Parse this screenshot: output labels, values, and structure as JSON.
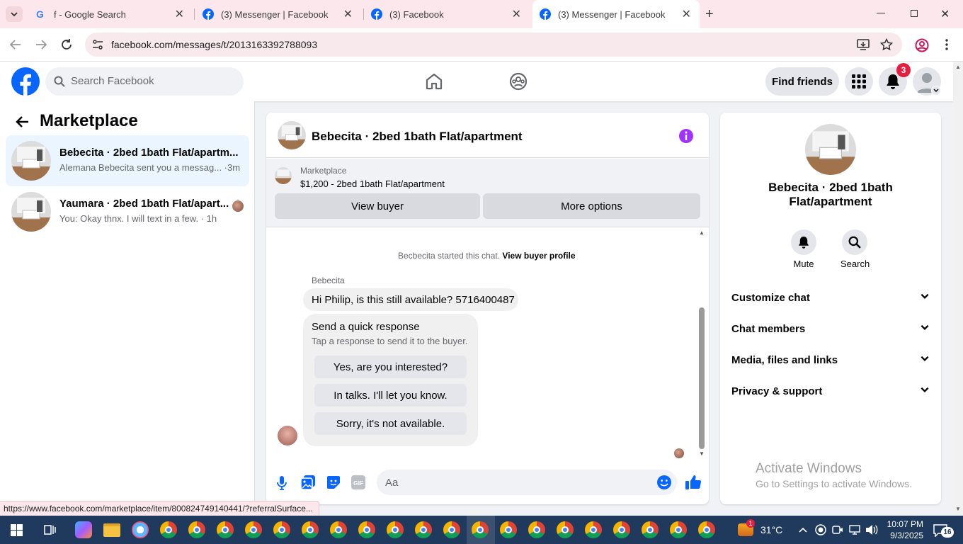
{
  "browser": {
    "tabs": [
      {
        "title": "f - Google Search",
        "favicon": "google-icon"
      },
      {
        "title": "(3) Messenger | Facebook",
        "favicon": "facebook-icon"
      },
      {
        "title": "(3) Facebook",
        "favicon": "facebook-icon"
      },
      {
        "title": "(3) Messenger | Facebook",
        "favicon": "facebook-icon"
      }
    ],
    "url": "facebook.com/messages/t/2013163392788093",
    "status_url": "https://www.facebook.com/marketplace/item/800824749140441/?referralSurface..."
  },
  "header": {
    "search_placeholder": "Search Facebook",
    "find_friends": "Find friends",
    "notification_count": "3"
  },
  "left": {
    "title": "Marketplace",
    "conversations": [
      {
        "title": "Bebecita · 2bed 1bath Flat/apartm...",
        "subtitle": "Alemana Bebecita sent you a messag... ·3m"
      },
      {
        "title": "Yaumara · 2bed 1bath Flat/apart...",
        "subtitle": "You: Okay thnx. I will text in a few. · 1h"
      }
    ]
  },
  "chat": {
    "title": "Bebecita · 2bed 1bath Flat/apartment",
    "marketplace_label": "Marketplace",
    "listing": "$1,200 - 2bed 1bath Flat/apartment",
    "view_buyer": "View buyer",
    "more_options": "More options",
    "started_text": "Becbecita started this chat.",
    "view_buyer_profile": "View buyer profile",
    "sender": "Bebecita",
    "message": "Hi Philip, is this still available? 5716400487",
    "quick_title": "Send a quick response",
    "quick_subtitle": "Tap a response to send it to the buyer.",
    "quick_responses": [
      "Yes, are you interested?",
      "In talks. I'll let you know.",
      "Sorry, it's not available."
    ],
    "composer_placeholder": "Aa"
  },
  "right": {
    "title_line1": "Bebecita · 2bed 1bath",
    "title_line2": "Flat/apartment",
    "mute": "Mute",
    "search": "Search",
    "sections": [
      "Customize chat",
      "Chat members",
      "Media, files and links",
      "Privacy & support"
    ],
    "watermark_title": "Activate Windows",
    "watermark_sub": "Go to Settings to activate Windows."
  },
  "taskbar": {
    "temperature": "31°C",
    "weather_badge": "1",
    "time": "10:07 PM",
    "date": "9/3/2025",
    "notification_count": "16"
  },
  "colors": {
    "facebook_blue": "#0866ff",
    "messenger_purple": "#a033ff",
    "notification_red": "#e41e3f"
  }
}
